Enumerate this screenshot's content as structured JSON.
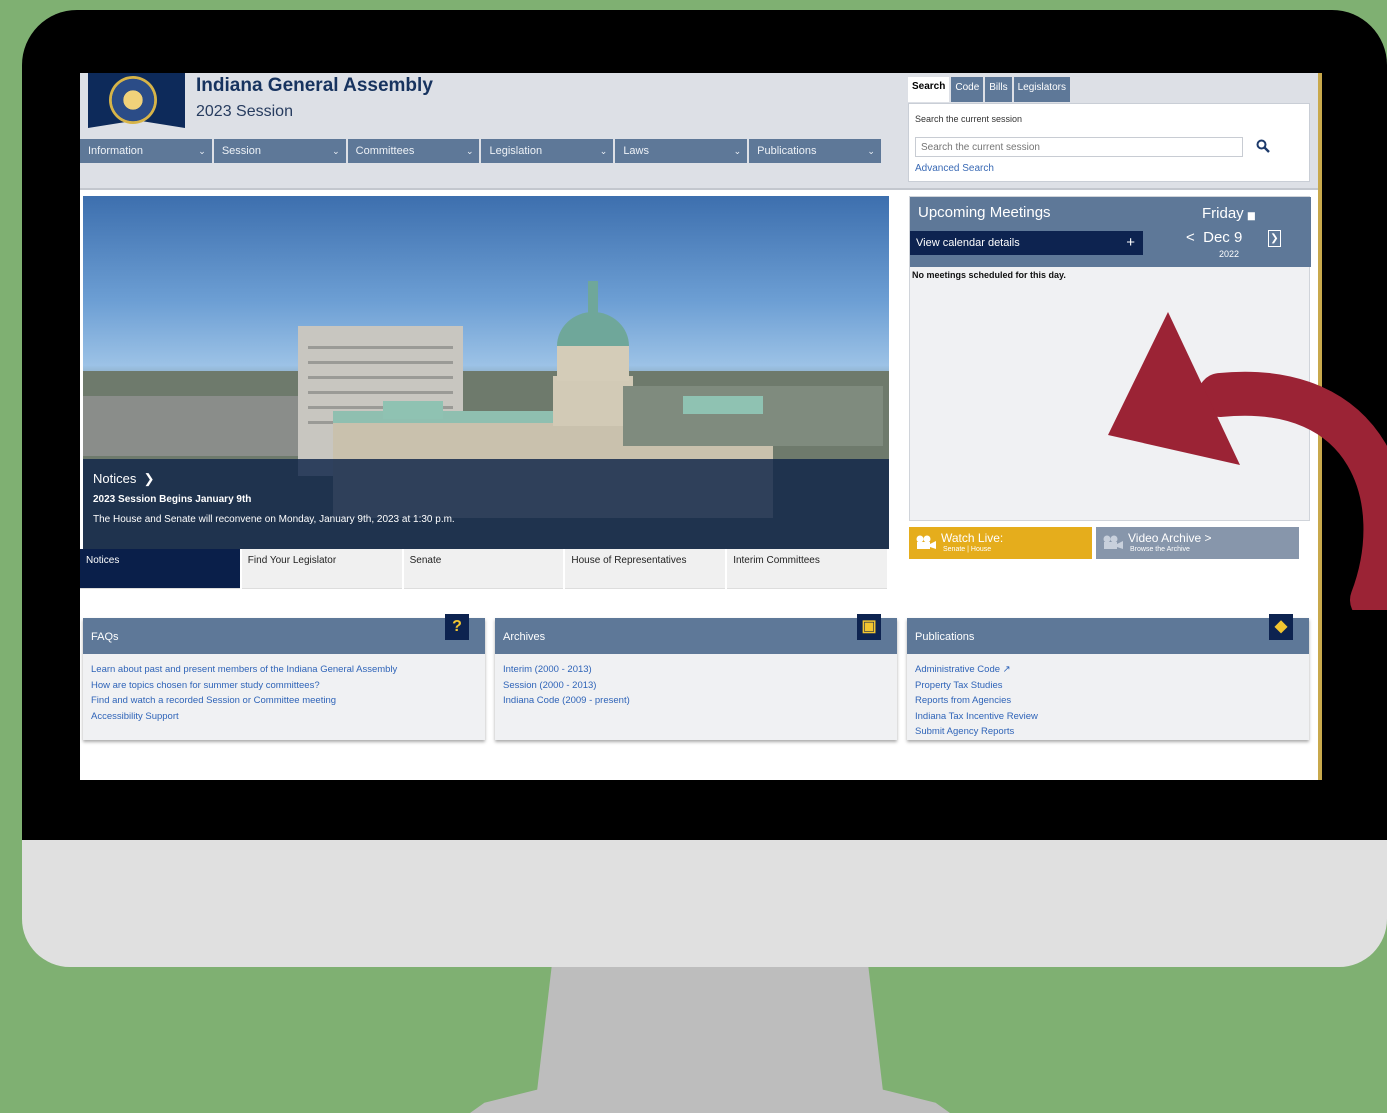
{
  "header": {
    "title": "Indiana General Assembly",
    "subtitle": "2023 Session"
  },
  "nav": {
    "items": [
      "Information",
      "Session",
      "Committees",
      "Legislation",
      "Laws",
      "Publications"
    ]
  },
  "search": {
    "tabs": [
      "Search",
      "Code",
      "Bills",
      "Legislators"
    ],
    "hint": "Search the current session",
    "placeholder": "Search the current session",
    "advanced": "Advanced Search"
  },
  "hero": {
    "notices_label": "Notices",
    "notice_title": "2023 Session Begins January 9th",
    "notice_text": "The House and Senate will reconvene on Monday, January 9th, 2023 at 1:30 p.m.",
    "tabs": [
      "Notices",
      "Find Your Legislator",
      "Senate",
      "House of Representatives",
      "Interim Committees"
    ]
  },
  "meetings": {
    "title": "Upcoming Meetings",
    "view_calendar": "View calendar details",
    "day": "Friday",
    "date": "Dec 9",
    "year": "2022",
    "prev": "<",
    "empty": "No meetings scheduled for this day."
  },
  "live": {
    "watch_title": "Watch Live:",
    "watch_sub": "Senate | House",
    "archive_title": "Video Archive >",
    "archive_sub": "Browse the Archive"
  },
  "faqs": {
    "title": "FAQs",
    "icon": "?",
    "links": [
      "Learn about past and present members of the Indiana General Assembly",
      "How are topics chosen for summer study committees?",
      "Find and watch a recorded Session or Committee meeting",
      "Accessibility Support"
    ]
  },
  "archives": {
    "title": "Archives",
    "links": [
      "Interim (2000 - 2013)",
      "Session (2000 - 2013)",
      "Indiana Code (2009 - present)"
    ]
  },
  "publications": {
    "title": "Publications",
    "links": [
      "Administrative Code",
      "Property Tax Studies",
      "Reports from Agencies",
      "Indiana Tax Incentive Review",
      "Submit Agency Reports"
    ]
  },
  "colors": {
    "background_green": "#7fb072",
    "arrow_red": "#9b2335",
    "nav_blue": "#5e7898",
    "navy": "#0d2350",
    "gold": "#e5ad1c"
  }
}
